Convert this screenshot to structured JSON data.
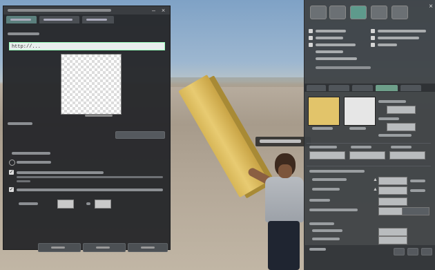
{
  "window": {
    "close_glyph": "×"
  },
  "texture_picker": {
    "url_value": "http://..."
  },
  "scene": {
    "has_selected_object": true
  },
  "colors": {
    "active_tab": "#5b7f7d",
    "object_color": "#e2c46a",
    "panel_bg": "#26282b"
  }
}
